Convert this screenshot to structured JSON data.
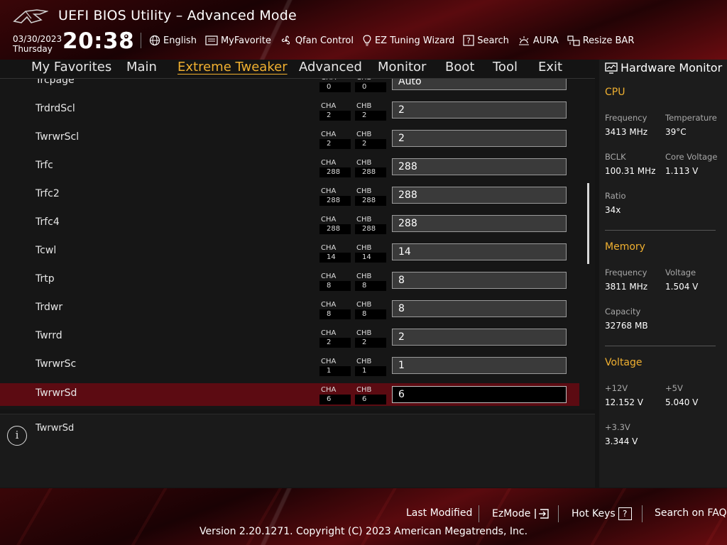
{
  "header": {
    "title": "UEFI BIOS Utility – Advanced Mode",
    "date": "03/30/2023",
    "weekday": "Thursday",
    "time": "20:38"
  },
  "toolbar": [
    {
      "label": "English",
      "icon": "globe-icon"
    },
    {
      "label": "MyFavorite",
      "icon": "favorite-icon"
    },
    {
      "label": "Qfan Control",
      "icon": "fan-icon"
    },
    {
      "label": "EZ Tuning Wizard",
      "icon": "bulb-icon"
    },
    {
      "label": "Search",
      "icon": "question-box-icon"
    },
    {
      "label": "AURA",
      "icon": "aura-icon"
    },
    {
      "label": "Resize BAR",
      "icon": "resize-bar-icon"
    }
  ],
  "menu": {
    "active": "Extreme Tweaker",
    "items": [
      "My Favorites",
      "Main",
      "Extreme Tweaker",
      "Advanced",
      "Monitor",
      "Boot",
      "Tool",
      "Exit"
    ]
  },
  "channels": {
    "a": "CHA",
    "b": "CHB"
  },
  "settings": [
    {
      "name": "Trcpage",
      "cha": "0",
      "chb": "0",
      "value": "Auto"
    },
    {
      "name": "TrdrdScl",
      "cha": "2",
      "chb": "2",
      "value": "2"
    },
    {
      "name": "TwrwrScl",
      "cha": "2",
      "chb": "2",
      "value": "2"
    },
    {
      "name": "Trfc",
      "cha": "288",
      "chb": "288",
      "value": "288"
    },
    {
      "name": "Trfc2",
      "cha": "288",
      "chb": "288",
      "value": "288"
    },
    {
      "name": "Trfc4",
      "cha": "288",
      "chb": "288",
      "value": "288"
    },
    {
      "name": "Tcwl",
      "cha": "14",
      "chb": "14",
      "value": "14"
    },
    {
      "name": "Trtp",
      "cha": "8",
      "chb": "8",
      "value": "8"
    },
    {
      "name": "Trdwr",
      "cha": "8",
      "chb": "8",
      "value": "8"
    },
    {
      "name": "Twrrd",
      "cha": "2",
      "chb": "2",
      "value": "2"
    },
    {
      "name": "TwrwrSc",
      "cha": "1",
      "chb": "1",
      "value": "1"
    },
    {
      "name": "TwrwrSd",
      "cha": "6",
      "chb": "6",
      "value": "6",
      "selected": true
    }
  ],
  "help": {
    "text": "TwrwrSd"
  },
  "hardware_monitor": {
    "title": "Hardware Monitor",
    "cpu": {
      "title": "CPU",
      "frequency_label": "Frequency",
      "frequency": "3413 MHz",
      "temperature_label": "Temperature",
      "temperature": "39°C",
      "bclk_label": "BCLK",
      "bclk": "100.31 MHz",
      "core_voltage_label": "Core Voltage",
      "core_voltage": "1.113 V",
      "ratio_label": "Ratio",
      "ratio": "34x"
    },
    "memory": {
      "title": "Memory",
      "frequency_label": "Frequency",
      "frequency": "3811 MHz",
      "voltage_label": "Voltage",
      "voltage": "1.504 V",
      "capacity_label": "Capacity",
      "capacity": "32768 MB"
    },
    "voltage": {
      "title": "Voltage",
      "v12_label": "+12V",
      "v12": "12.152 V",
      "v5_label": "+5V",
      "v5": "5.040 V",
      "v33_label": "+3.3V",
      "v33": "3.344 V"
    }
  },
  "footer": {
    "last_modified": "Last Modified",
    "ezmode": "EzMode",
    "hot_keys": "Hot Keys",
    "hot_keys_key": "?",
    "search_faq": "Search on FAQ",
    "copyright": "Version 2.20.1271. Copyright (C) 2023 American Megatrends, Inc."
  },
  "colors": {
    "accent": "#f0b030",
    "selected_row": "#5c0b12"
  }
}
